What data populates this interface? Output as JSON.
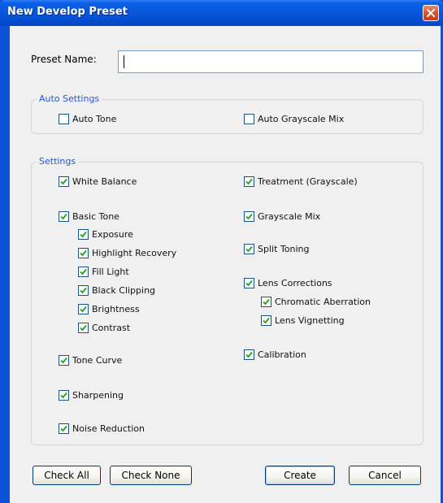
{
  "window": {
    "title": "New Develop Preset"
  },
  "preset": {
    "label": "Preset Name:",
    "value": ""
  },
  "auto_settings": {
    "title": "Auto Settings",
    "items": [
      {
        "label": "Auto Tone",
        "checked": false
      },
      {
        "label": "Auto Grayscale Mix",
        "checked": false
      }
    ]
  },
  "settings": {
    "title": "Settings",
    "left": [
      {
        "label": "White Balance",
        "checked": true
      },
      {
        "label": "Basic Tone",
        "checked": true
      },
      {
        "label": "Exposure",
        "checked": true
      },
      {
        "label": "Highlight Recovery",
        "checked": true
      },
      {
        "label": "Fill Light",
        "checked": true
      },
      {
        "label": "Black Clipping",
        "checked": true
      },
      {
        "label": "Brightness",
        "checked": true
      },
      {
        "label": "Contrast",
        "checked": true
      },
      {
        "label": "Tone Curve",
        "checked": true
      },
      {
        "label": "Sharpening",
        "checked": true
      },
      {
        "label": "Noise Reduction",
        "checked": true
      }
    ],
    "right": [
      {
        "label": "Treatment (Grayscale)",
        "checked": true
      },
      {
        "label": "Grayscale Mix",
        "checked": true
      },
      {
        "label": "Split Toning",
        "checked": true
      },
      {
        "label": "Lens Corrections",
        "checked": true
      },
      {
        "label": "Chromatic Aberration",
        "checked": true
      },
      {
        "label": "Lens Vignetting",
        "checked": true
      },
      {
        "label": "Calibration",
        "checked": true
      }
    ]
  },
  "buttons": {
    "check_all": "Check All",
    "check_none": "Check None",
    "create": "Create",
    "cancel": "Cancel"
  },
  "colors": {
    "titlebar": "#0553d8",
    "group_title": "#2a55c8",
    "checkmark": "#21a121"
  }
}
